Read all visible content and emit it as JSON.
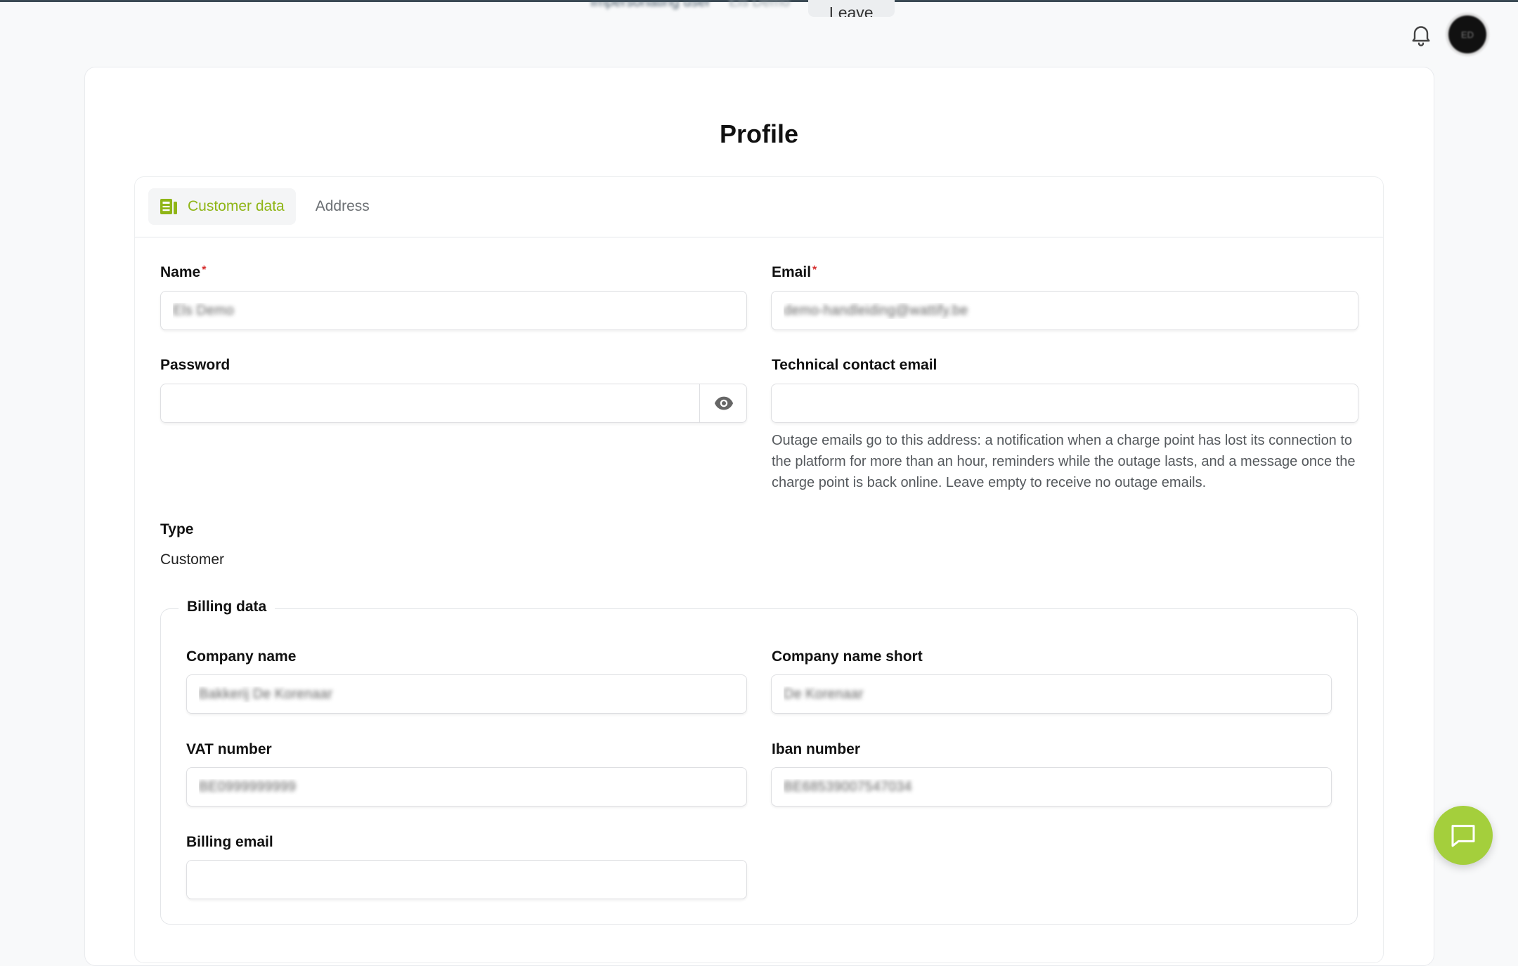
{
  "impersonation": {
    "text": "Impersonating user",
    "subtext": "Els Demo",
    "leave_label": "Leave"
  },
  "header": {
    "avatar_initials": "ED"
  },
  "page": {
    "title": "Profile"
  },
  "tabs": [
    {
      "label": "Customer data",
      "icon": "document-icon",
      "active": true
    },
    {
      "label": "Address",
      "active": false
    }
  ],
  "customer": {
    "name_label": "Name",
    "name_value": "Els Demo",
    "email_label": "Email",
    "email_value": "demo-handleiding@wattify.be",
    "required_mark": "*",
    "password_label": "Password",
    "password_value": "",
    "technical_email_label": "Technical contact email",
    "technical_email_value": "",
    "technical_email_help": "Outage emails go to this address: a notification when a charge point has lost its connection to the platform for more than an hour, reminders while the outage lasts, and a message once the charge point is back online. Leave empty to receive no outage emails.",
    "type_label": "Type",
    "type_value": "Customer"
  },
  "billing": {
    "legend": "Billing data",
    "company_name_label": "Company name",
    "company_name_value": "Bakkerij De Korenaar",
    "company_short_label": "Company name short",
    "company_short_value": "De Korenaar",
    "vat_label": "VAT number",
    "vat_value": "BE0999999999",
    "iban_label": "Iban number",
    "iban_value": "BE68539007547034",
    "billing_email_label": "Billing email",
    "billing_email_value": ""
  },
  "colors": {
    "accent": "#8fb516",
    "fab": "#a4cf3c",
    "required": "#d62f2f"
  }
}
